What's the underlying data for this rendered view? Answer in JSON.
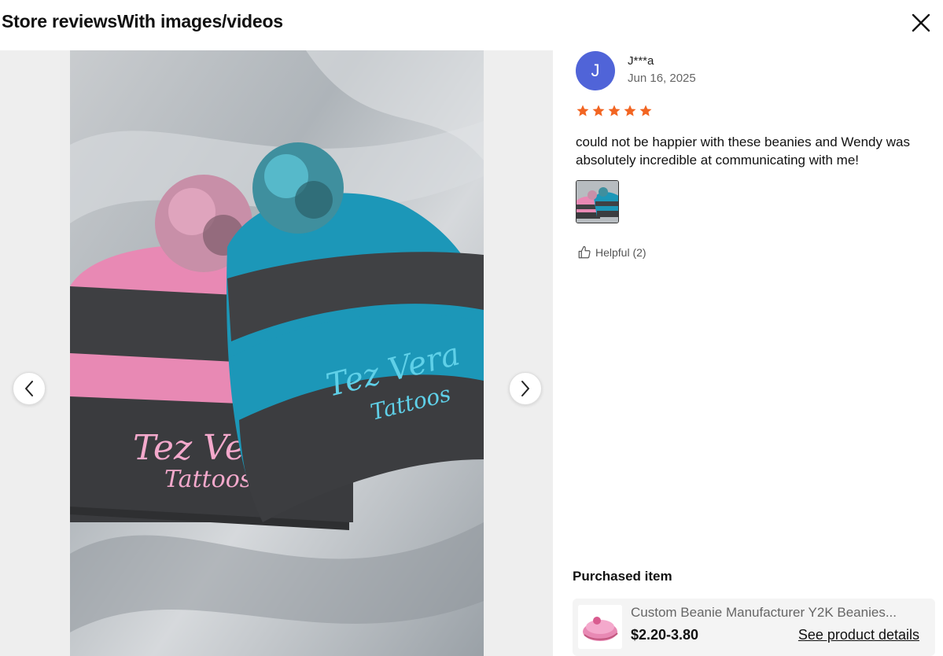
{
  "header": {
    "title": "Store reviewsWith images/videos",
    "close_icon": "close-icon"
  },
  "media": {
    "prev_icon": "chevron-left-icon",
    "next_icon": "chevron-right-icon",
    "photo_description_icon": "beanie-photo"
  },
  "review": {
    "avatar_initial": "J",
    "reviewer_name": "J***a",
    "date": "Jun 16, 2025",
    "rating": 5,
    "rating_max": 5,
    "star_color": "#f26522",
    "text": "could not be happier with these beanies and Wendy was absolutely incredible at communicating with me!",
    "helpful_label": "Helpful (2)"
  },
  "purchased": {
    "label": "Purchased item",
    "product_name": "Custom Beanie Manufacturer Y2K Beanies...",
    "price": "$2.20-3.80",
    "details_link": "See product details"
  },
  "colors": {
    "avatar": "#5064d8",
    "accent_star": "#f26522"
  }
}
